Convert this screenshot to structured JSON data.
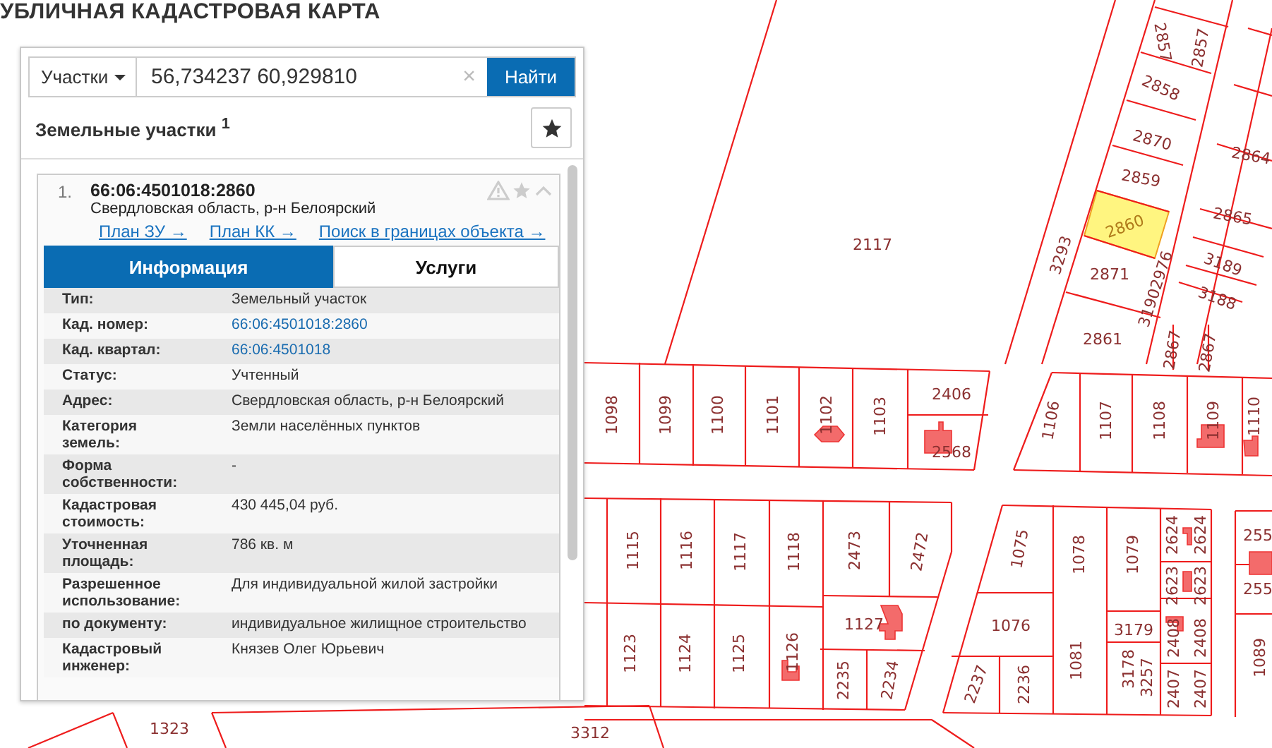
{
  "page_title": "УБЛИЧНАЯ КАДАСТРОВАЯ КАРТА",
  "search": {
    "category": "Участки",
    "value": "56,734237 60,929810",
    "clear": "×",
    "button": "Найти"
  },
  "results": {
    "title": "Земельные участки",
    "count": "1",
    "items": [
      {
        "index": "1.",
        "number": "66:06:4501018:2860",
        "address": "Свердловская область, р-н Белоярский",
        "links": [
          "План ЗУ →",
          "План КК →",
          "Поиск в границах объекта →"
        ],
        "tabs": [
          {
            "label": "Информация",
            "selected": true
          },
          {
            "label": "Услуги",
            "selected": false
          }
        ],
        "rows": [
          {
            "label": "Тип:",
            "value": "Земельный участок",
            "kind": "text"
          },
          {
            "label": "Кад. номер:",
            "value": "66:06:4501018:2860",
            "kind": "link"
          },
          {
            "label": "Кад. квартал:",
            "value": "66:06:4501018",
            "kind": "link"
          },
          {
            "label": "Статус:",
            "value": "Учтенный",
            "kind": "text"
          },
          {
            "label": "Адрес:",
            "value": "Свердловская область, р-н Белоярский",
            "kind": "text"
          },
          {
            "label": "Категория земель:",
            "value": "Земли населённых пунктов",
            "kind": "text"
          },
          {
            "label": "Форма собственности:",
            "value": "-",
            "kind": "text"
          },
          {
            "label": "Кадастровая стоимость:",
            "value": "430 445,04 руб.",
            "kind": "text"
          },
          {
            "label": "Уточненная площадь:",
            "value": "786 кв. м",
            "kind": "text"
          },
          {
            "label": "Разрешенное использование:",
            "value": "Для индивидуальной жилой застройки",
            "kind": "text"
          },
          {
            "label": "по документу:",
            "value": "индивидуальное жилищное строительство",
            "kind": "text"
          },
          {
            "label": "Кадастровый инженер:",
            "value": "Князев Олег Юрьевич",
            "kind": "text"
          }
        ]
      }
    ]
  },
  "map": {
    "parcels": [
      {
        "number": "2860",
        "selected": true
      },
      {
        "number": "2857",
        "selected": false
      },
      {
        "number": "2857",
        "selected": false
      },
      {
        "number": "2858",
        "selected": false
      },
      {
        "number": "2870",
        "selected": false
      },
      {
        "number": "2859",
        "selected": false
      },
      {
        "number": "2864",
        "selected": false
      },
      {
        "number": "2865",
        "selected": false
      },
      {
        "number": "3189",
        "selected": false
      },
      {
        "number": "3188",
        "selected": false
      },
      {
        "number": "2871",
        "selected": false
      },
      {
        "number": "3293",
        "selected": false
      },
      {
        "number": "31902976",
        "selected": false
      },
      {
        "number": "2861",
        "selected": false
      },
      {
        "number": "2867",
        "selected": false
      },
      {
        "number": "2867",
        "selected": false
      },
      {
        "number": "2117",
        "selected": false
      },
      {
        "number": "1098",
        "selected": false
      },
      {
        "number": "1099",
        "selected": false
      },
      {
        "number": "1100",
        "selected": false
      },
      {
        "number": "1101",
        "selected": false
      },
      {
        "number": "1102",
        "selected": false
      },
      {
        "number": "1103",
        "selected": false
      },
      {
        "number": "2406",
        "selected": false
      },
      {
        "number": "2568",
        "selected": false
      },
      {
        "number": "1106",
        "selected": false
      },
      {
        "number": "1107",
        "selected": false
      },
      {
        "number": "1108",
        "selected": false
      },
      {
        "number": "1109",
        "selected": false
      },
      {
        "number": "1110",
        "selected": false
      },
      {
        "number": "1115",
        "selected": false
      },
      {
        "number": "1116",
        "selected": false
      },
      {
        "number": "1117",
        "selected": false
      },
      {
        "number": "1118",
        "selected": false
      },
      {
        "number": "2473",
        "selected": false
      },
      {
        "number": "2472",
        "selected": false
      },
      {
        "number": "1075",
        "selected": false
      },
      {
        "number": "1078",
        "selected": false
      },
      {
        "number": "1079",
        "selected": false
      },
      {
        "number": "2624",
        "selected": false
      },
      {
        "number": "2624",
        "selected": false
      },
      {
        "number": "2623",
        "selected": false
      },
      {
        "number": "2623",
        "selected": false
      },
      {
        "number": "255",
        "selected": false
      },
      {
        "number": "255",
        "selected": false
      },
      {
        "number": "1123",
        "selected": false
      },
      {
        "number": "1124",
        "selected": false
      },
      {
        "number": "1125",
        "selected": false
      },
      {
        "number": "1126",
        "selected": false
      },
      {
        "number": "1127",
        "selected": false
      },
      {
        "number": "2235",
        "selected": false
      },
      {
        "number": "2234",
        "selected": false
      },
      {
        "number": "2237",
        "selected": false
      },
      {
        "number": "2236",
        "selected": false
      },
      {
        "number": "1076",
        "selected": false
      },
      {
        "number": "1081",
        "selected": false
      },
      {
        "number": "3179",
        "selected": false
      },
      {
        "number": "2408",
        "selected": false
      },
      {
        "number": "2408",
        "selected": false
      },
      {
        "number": "3178",
        "selected": false
      },
      {
        "number": "3257",
        "selected": false
      },
      {
        "number": "2407",
        "selected": false
      },
      {
        "number": "2407",
        "selected": false
      },
      {
        "number": "1089",
        "selected": false
      },
      {
        "number": "1323",
        "selected": false
      },
      {
        "number": "3312",
        "selected": false
      }
    ]
  }
}
